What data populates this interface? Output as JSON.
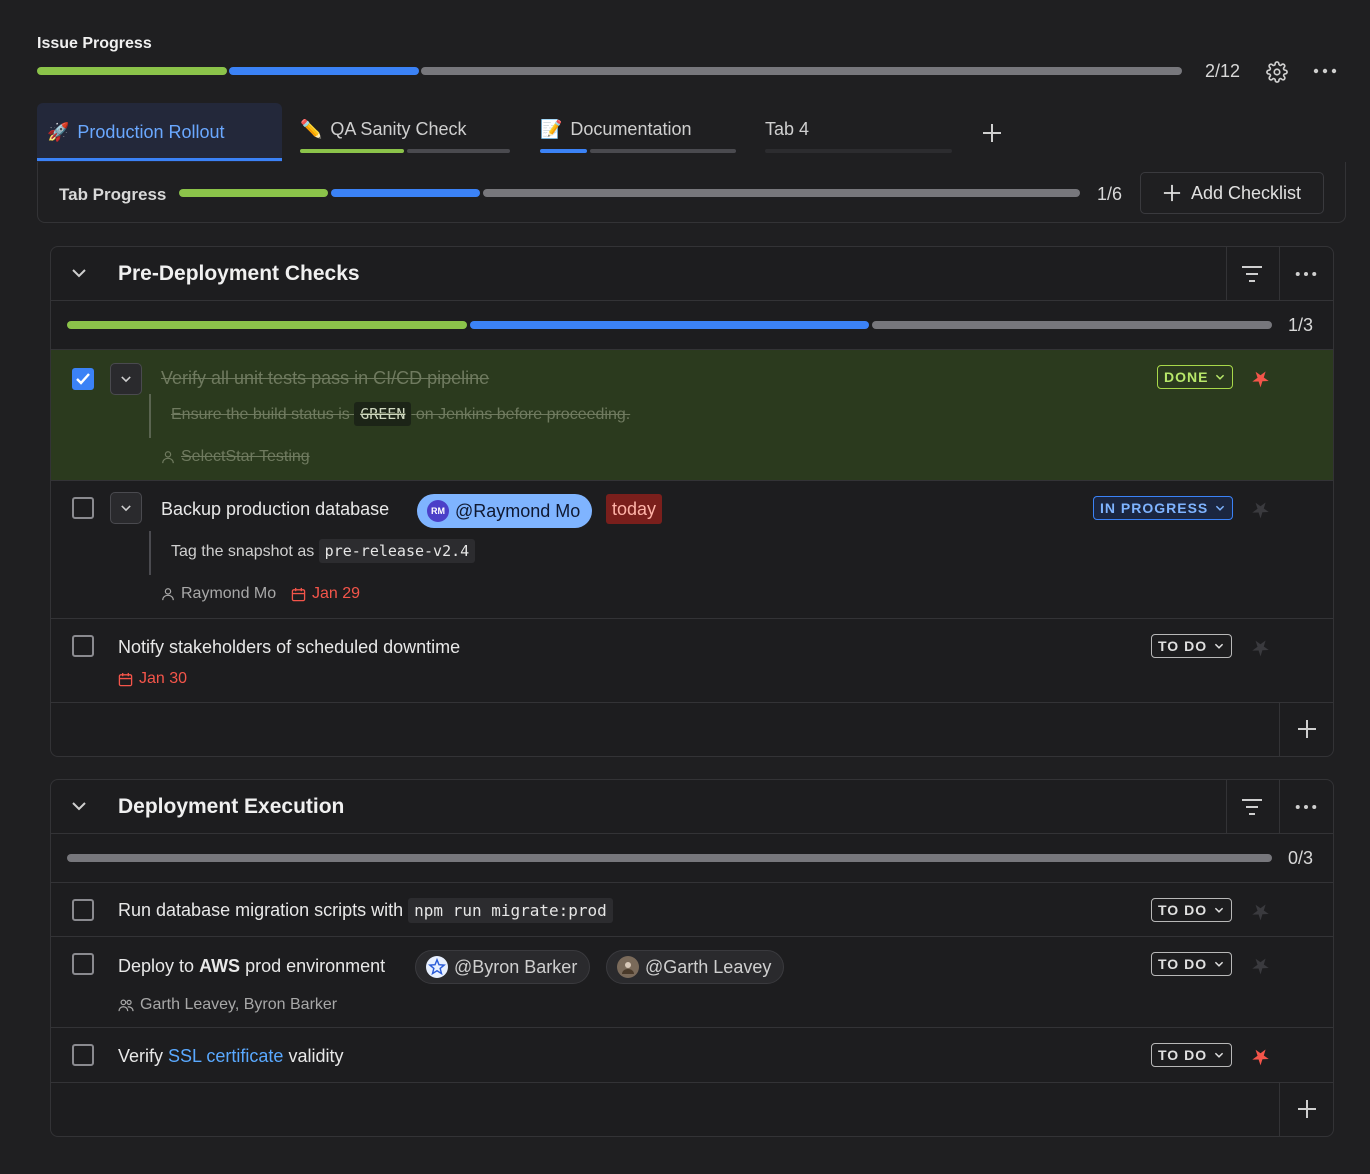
{
  "header": {
    "title": "Issue Progress",
    "count": "2/12",
    "progress": {
      "done": 2,
      "in_progress": 2,
      "total": 12
    }
  },
  "tabs": [
    {
      "label": "Production Rollout",
      "icon": "rocket-icon",
      "active": true
    },
    {
      "label": "QA Sanity Check",
      "icon": "pencil-icon",
      "active": false
    },
    {
      "label": "Documentation",
      "icon": "memo-icon",
      "active": false
    },
    {
      "label": "Tab 4",
      "icon": "",
      "active": false
    }
  ],
  "tab_progress": {
    "label": "Tab Progress",
    "count": "1/6",
    "add_checklist": "Add Checklist"
  },
  "colors": {
    "done": "#8bc34a",
    "in_progress": "#3b82f6",
    "todo": "#77777c",
    "danger": "#f4554a",
    "done_row_bg": "#2b3a1e",
    "link": "#5aa9ff"
  },
  "sections": [
    {
      "title": "Pre-Deployment Checks",
      "count": "1/3",
      "progress": {
        "done": 1,
        "in_progress": 1,
        "total": 3
      },
      "items": [
        {
          "text": "Verify all unit tests pass in CI/CD pipeline",
          "checked": true,
          "status": "DONE",
          "starred": true,
          "note_before": "Ensure the build status is",
          "note_code": "GREEN",
          "note_after": "on Jenkins before proceeding.",
          "assignee": "SelectStar Testing"
        },
        {
          "text": "Backup production database",
          "checked": false,
          "status": "IN PROGRESS",
          "starred": false,
          "mention": "@Raymond Mo",
          "mention_initials": "RM",
          "due_tag": "today",
          "note_before": "Tag the snapshot as",
          "note_code": "pre-release-v2.4",
          "assignee": "Raymond Mo",
          "due": "Jan 29"
        },
        {
          "text": "Notify stakeholders of scheduled downtime",
          "checked": false,
          "status": "TO DO",
          "starred": false,
          "due": "Jan 30"
        }
      ]
    },
    {
      "title": "Deployment Execution",
      "count": "0/3",
      "progress": {
        "done": 0,
        "in_progress": 0,
        "total": 3
      },
      "items": [
        {
          "text": "Run database migration scripts with",
          "code": "npm run migrate:prod",
          "checked": false,
          "status": "TO DO",
          "starred": false
        },
        {
          "text_before": "Deploy to",
          "text_bold": "AWS",
          "text_after": "prod environment",
          "checked": false,
          "status": "TO DO",
          "starred": false,
          "mention1": "@Byron Barker",
          "mention2": "@Garth Leavey",
          "assignees": "Garth Leavey, Byron Barker"
        },
        {
          "text_before": "Verify",
          "link": "SSL certificate",
          "text_after": "validity",
          "checked": false,
          "status": "TO DO",
          "starred": true
        }
      ]
    }
  ]
}
